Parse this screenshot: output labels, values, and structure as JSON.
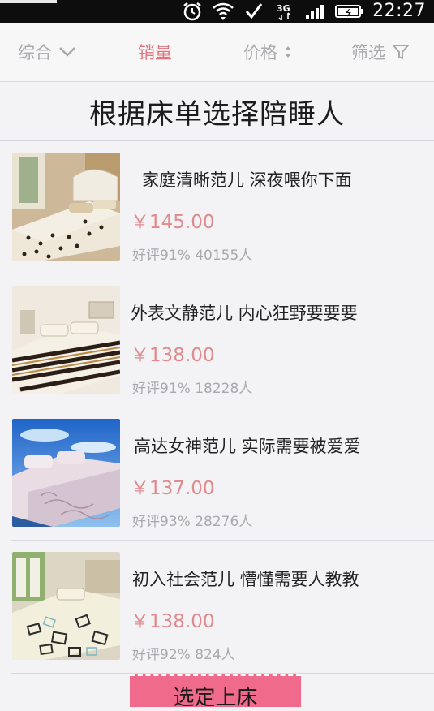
{
  "status_bar": {
    "time": "22:27",
    "icons": [
      "alarm-icon",
      "wifi-icon",
      "check-icon",
      "network-3g-icon",
      "signal-icon",
      "battery-charging-icon"
    ]
  },
  "filters": [
    {
      "label": "综合",
      "icon": "chevron-down-icon",
      "active": false
    },
    {
      "label": "销量",
      "icon": "",
      "active": true
    },
    {
      "label": "价格",
      "icon": "sort-updown-icon",
      "active": false
    },
    {
      "label": "筛选",
      "icon": "funnel-icon",
      "active": false
    }
  ],
  "page_title": "根据床单选择陪睡人",
  "products": [
    {
      "title": "家庭清晰范儿 深夜喂你下面",
      "price": "￥145.00",
      "stats": "好评91% 40155人"
    },
    {
      "title": "外表文静范儿 内心狂野要要要",
      "price": "￥138.00",
      "stats": "好评91% 18228人"
    },
    {
      "title": "高达女神范儿 实际需要被爱爱",
      "price": "￥137.00",
      "stats": "好评93% 28276人"
    },
    {
      "title": "初入社会范儿 懵懂需要人教教",
      "price": "￥138.00",
      "stats": "好评92% 824人"
    }
  ],
  "cta_label": "选定上床",
  "colors": {
    "accent": "#e2747b",
    "price": "#e08a8e",
    "cta": "#f06a8c"
  }
}
